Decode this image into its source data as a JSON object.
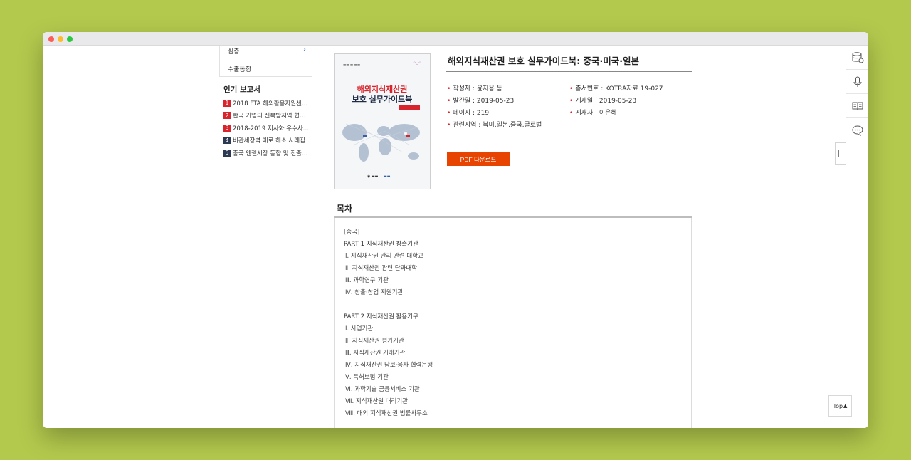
{
  "sidebar": {
    "items": [
      {
        "label": "심층"
      },
      {
        "label": "수출동향"
      }
    ],
    "popular_title": "인기 보고서",
    "popular": [
      {
        "rank": "1",
        "title": "2018 FTA 해외활용지원센…"
      },
      {
        "rank": "2",
        "title": "한국 기업의 신북방지역 협…"
      },
      {
        "rank": "3",
        "title": "2018-2019 지사화 우수사…"
      },
      {
        "rank": "4",
        "title": "비관세장벽 애로 해소 사례집"
      },
      {
        "rank": "5",
        "title": "중국 엔젤시장 동향 및 진출…"
      }
    ]
  },
  "cover": {
    "title_line1": "해외지식재산권",
    "title_line2": "보호 실무가이드북"
  },
  "book": {
    "title": "해외지식재산권 보호 실무가이드북: 중국·미국·일본",
    "meta": {
      "author": "작성자 : 윤지용 등",
      "series": "총서번호 : KOTRA자료 19-027",
      "published": "발간일 : 2019-05-23",
      "posted": "게재일 : 2019-05-23",
      "pages": "페이지 : 219",
      "poster": "게재자 : 이은혜",
      "regions": "관련지역 : 북미,일본,중국,글로벌"
    },
    "pdf_label": "PDF 다운로드"
  },
  "toc": {
    "heading": "목차",
    "lines": [
      "[중국]",
      "PART 1 지식재산권 창출기관",
      "Ⅰ. 지식재산권 관리 관련 대학교",
      "Ⅱ. 지식재산권 관련 단과대학",
      "Ⅲ. 과학연구 기관",
      "Ⅳ. 창출·창업 지원기관",
      "",
      "PART 2 지식재산권 활용기구",
      "Ⅰ. 사업기관",
      "Ⅱ. 지식재산권 평가기관",
      "Ⅲ. 지식재산권 거래기관",
      "Ⅳ. 지식재산권 담보·융자 협력은행",
      "Ⅴ. 특허보험 기관",
      "Ⅵ. 과학기술 금융서비스 기관",
      "Ⅶ. 지식재산권 대리기관",
      "Ⅷ. 대외 지식재산권 법률사무소"
    ]
  },
  "rail": {
    "toggle": "|||",
    "top_label": "Top",
    "top_arrow": "▲"
  },
  "colors": {
    "accent": "#e64400",
    "rank_hot": "#d8242c",
    "rank_cool": "#2b3a52",
    "background": "#b3c94d"
  }
}
